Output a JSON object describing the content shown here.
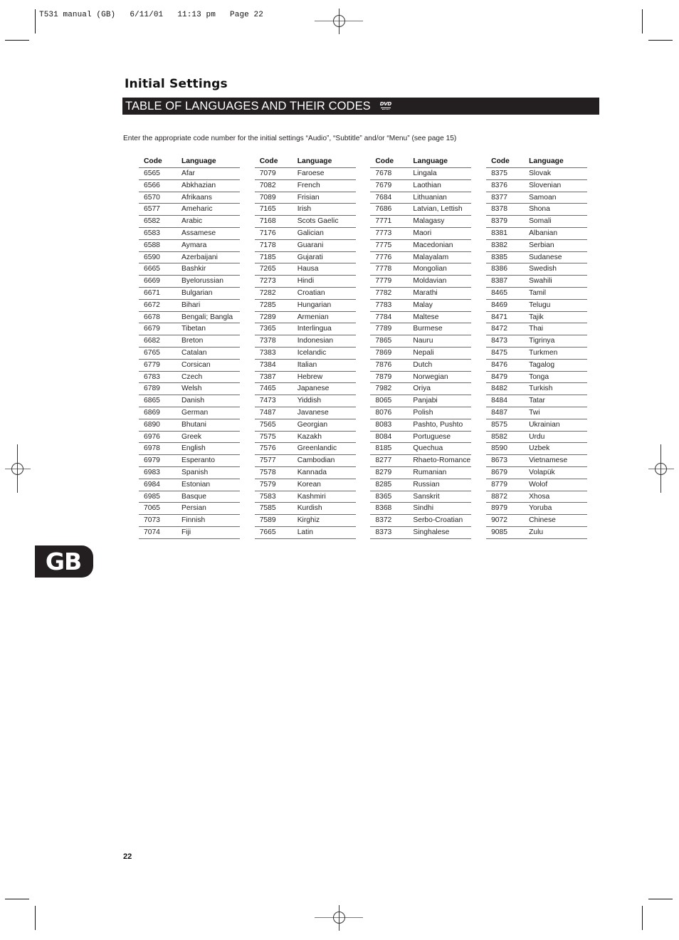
{
  "print_slug": "T531 manual (GB)   6/11/01   11:13 pm   Page 22",
  "section_title": "Initial Settings",
  "banner": {
    "title": "TABLE OF LANGUAGES AND THEIR CODES",
    "logo_text": "DVD",
    "logo_icon": "dvd-video-logo"
  },
  "intro_text": "Enter the appropriate code number for the initial settings “Audio”, “Subtitle” and/or “Menu” (see page 15)",
  "table_headers": {
    "code": "Code",
    "language": "Language"
  },
  "tables": [
    {
      "rows": [
        {
          "code": "6565",
          "language": "Afar"
        },
        {
          "code": "6566",
          "language": "Abkhazian"
        },
        {
          "code": "6570",
          "language": "Afrikaans"
        },
        {
          "code": "6577",
          "language": "Ameharic"
        },
        {
          "code": "6582",
          "language": "Arabic"
        },
        {
          "code": "6583",
          "language": "Assamese"
        },
        {
          "code": "6588",
          "language": "Aymara"
        },
        {
          "code": "6590",
          "language": "Azerbaijani"
        },
        {
          "code": "6665",
          "language": "Bashkir"
        },
        {
          "code": "6669",
          "language": "Byelorussian"
        },
        {
          "code": "6671",
          "language": "Bulgarian"
        },
        {
          "code": "6672",
          "language": "Bihari"
        },
        {
          "code": "6678",
          "language": "Bengali; Bangla"
        },
        {
          "code": "6679",
          "language": "Tibetan"
        },
        {
          "code": "6682",
          "language": "Breton"
        },
        {
          "code": "6765",
          "language": "Catalan"
        },
        {
          "code": "6779",
          "language": "Corsican"
        },
        {
          "code": "6783",
          "language": "Czech"
        },
        {
          "code": "6789",
          "language": "Welsh"
        },
        {
          "code": "6865",
          "language": "Danish"
        },
        {
          "code": "6869",
          "language": "German"
        },
        {
          "code": "6890",
          "language": "Bhutani"
        },
        {
          "code": "6976",
          "language": "Greek"
        },
        {
          "code": "6978",
          "language": "English"
        },
        {
          "code": "6979",
          "language": "Esperanto"
        },
        {
          "code": "6983",
          "language": "Spanish"
        },
        {
          "code": "6984",
          "language": "Estonian"
        },
        {
          "code": "6985",
          "language": "Basque"
        },
        {
          "code": "7065",
          "language": "Persian"
        },
        {
          "code": "7073",
          "language": "Finnish"
        },
        {
          "code": "7074",
          "language": "Fiji"
        }
      ]
    },
    {
      "rows": [
        {
          "code": "7079",
          "language": "Faroese"
        },
        {
          "code": "7082",
          "language": "French"
        },
        {
          "code": "7089",
          "language": "Frisian"
        },
        {
          "code": "7165",
          "language": "Irish"
        },
        {
          "code": "7168",
          "language": "Scots Gaelic"
        },
        {
          "code": "7176",
          "language": "Galician"
        },
        {
          "code": "7178",
          "language": "Guarani"
        },
        {
          "code": "7185",
          "language": "Gujarati"
        },
        {
          "code": "7265",
          "language": "Hausa"
        },
        {
          "code": "7273",
          "language": "Hindi"
        },
        {
          "code": "7282",
          "language": "Croatian"
        },
        {
          "code": "7285",
          "language": "Hungarian"
        },
        {
          "code": "7289",
          "language": "Armenian"
        },
        {
          "code": "7365",
          "language": "Interlingua"
        },
        {
          "code": "7378",
          "language": "Indonesian"
        },
        {
          "code": "7383",
          "language": "Icelandic"
        },
        {
          "code": "7384",
          "language": "Italian"
        },
        {
          "code": "7387",
          "language": "Hebrew"
        },
        {
          "code": "7465",
          "language": "Japanese"
        },
        {
          "code": "7473",
          "language": "Yiddish"
        },
        {
          "code": "7487",
          "language": "Javanese"
        },
        {
          "code": "7565",
          "language": "Georgian"
        },
        {
          "code": "7575",
          "language": "Kazakh"
        },
        {
          "code": "7576",
          "language": "Greenlandic"
        },
        {
          "code": "7577",
          "language": "Cambodian"
        },
        {
          "code": "7578",
          "language": "Kannada"
        },
        {
          "code": "7579",
          "language": "Korean"
        },
        {
          "code": "7583",
          "language": "Kashmiri"
        },
        {
          "code": "7585",
          "language": "Kurdish"
        },
        {
          "code": "7589",
          "language": "Kirghiz"
        },
        {
          "code": "7665",
          "language": "Latin"
        }
      ]
    },
    {
      "rows": [
        {
          "code": "7678",
          "language": "Lingala"
        },
        {
          "code": "7679",
          "language": "Laothian"
        },
        {
          "code": "7684",
          "language": "Lithuanian"
        },
        {
          "code": "7686",
          "language": "Latvian, Lettish"
        },
        {
          "code": "7771",
          "language": "Malagasy"
        },
        {
          "code": "7773",
          "language": "Maori"
        },
        {
          "code": "7775",
          "language": "Macedonian"
        },
        {
          "code": "7776",
          "language": "Malayalam"
        },
        {
          "code": "7778",
          "language": "Mongolian"
        },
        {
          "code": "7779",
          "language": "Moldavian"
        },
        {
          "code": "7782",
          "language": "Marathi"
        },
        {
          "code": "7783",
          "language": "Malay"
        },
        {
          "code": "7784",
          "language": "Maltese"
        },
        {
          "code": "7789",
          "language": "Burmese"
        },
        {
          "code": "7865",
          "language": "Nauru"
        },
        {
          "code": "7869",
          "language": "Nepali"
        },
        {
          "code": "7876",
          "language": "Dutch"
        },
        {
          "code": "7879",
          "language": "Norwegian"
        },
        {
          "code": "7982",
          "language": "Oriya"
        },
        {
          "code": "8065",
          "language": "Panjabi"
        },
        {
          "code": "8076",
          "language": "Polish"
        },
        {
          "code": "8083",
          "language": "Pashto, Pushto"
        },
        {
          "code": "8084",
          "language": "Portuguese"
        },
        {
          "code": "8185",
          "language": "Quechua"
        },
        {
          "code": "8277",
          "language": "Rhaeto-Romance"
        },
        {
          "code": "8279",
          "language": "Rumanian"
        },
        {
          "code": "8285",
          "language": "Russian"
        },
        {
          "code": "8365",
          "language": "Sanskrit"
        },
        {
          "code": "8368",
          "language": "Sindhi"
        },
        {
          "code": "8372",
          "language": "Serbo-Croatian"
        },
        {
          "code": "8373",
          "language": "Singhalese"
        }
      ]
    },
    {
      "rows": [
        {
          "code": "8375",
          "language": "Slovak"
        },
        {
          "code": "8376",
          "language": "Slovenian"
        },
        {
          "code": "8377",
          "language": "Samoan"
        },
        {
          "code": "8378",
          "language": "Shona"
        },
        {
          "code": "8379",
          "language": "Somali"
        },
        {
          "code": "8381",
          "language": "Albanian"
        },
        {
          "code": "8382",
          "language": "Serbian"
        },
        {
          "code": "8385",
          "language": "Sudanese"
        },
        {
          "code": "8386",
          "language": "Swedish"
        },
        {
          "code": "8387",
          "language": "Swahili"
        },
        {
          "code": "8465",
          "language": "Tamil"
        },
        {
          "code": "8469",
          "language": "Telugu"
        },
        {
          "code": "8471",
          "language": "Tajik"
        },
        {
          "code": "8472",
          "language": "Thai"
        },
        {
          "code": "8473",
          "language": "Tigrinya"
        },
        {
          "code": "8475",
          "language": "Turkmen"
        },
        {
          "code": "8476",
          "language": "Tagalog"
        },
        {
          "code": "8479",
          "language": "Tonga"
        },
        {
          "code": "8482",
          "language": "Turkish"
        },
        {
          "code": "8484",
          "language": "Tatar"
        },
        {
          "code": "8487",
          "language": "Twi"
        },
        {
          "code": "8575",
          "language": "Ukrainian"
        },
        {
          "code": "8582",
          "language": "Urdu"
        },
        {
          "code": "8590",
          "language": "Uzbek"
        },
        {
          "code": "8673",
          "language": "Vietnamese"
        },
        {
          "code": "8679",
          "language": "Volapük"
        },
        {
          "code": "8779",
          "language": "Wolof"
        },
        {
          "code": "8872",
          "language": "Xhosa"
        },
        {
          "code": "8979",
          "language": "Yoruba"
        },
        {
          "code": "9072",
          "language": "Chinese"
        },
        {
          "code": "9085",
          "language": "Zulu"
        }
      ]
    }
  ],
  "language_badge": "GB",
  "page_number": "22",
  "colors": {
    "banner_bg": "#231f20",
    "text": "#231f20",
    "rule": "#6d6d6d"
  }
}
